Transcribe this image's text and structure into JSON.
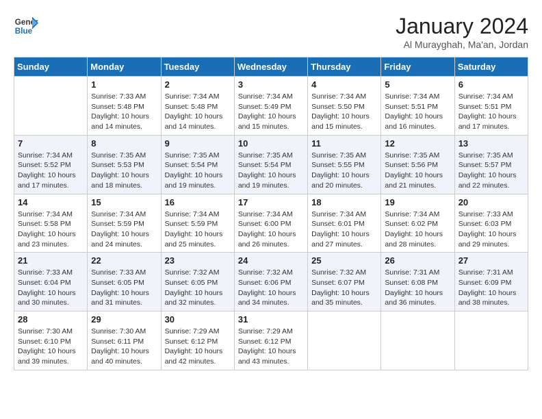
{
  "header": {
    "logo_line1": "General",
    "logo_line2": "Blue",
    "title": "January 2024",
    "subtitle": "Al Murayghah, Ma'an, Jordan"
  },
  "weekdays": [
    "Sunday",
    "Monday",
    "Tuesday",
    "Wednesday",
    "Thursday",
    "Friday",
    "Saturday"
  ],
  "weeks": [
    [
      {
        "day": "",
        "sunrise": "",
        "sunset": "",
        "daylight": ""
      },
      {
        "day": "1",
        "sunrise": "Sunrise: 7:33 AM",
        "sunset": "Sunset: 5:48 PM",
        "daylight": "Daylight: 10 hours and 14 minutes."
      },
      {
        "day": "2",
        "sunrise": "Sunrise: 7:34 AM",
        "sunset": "Sunset: 5:48 PM",
        "daylight": "Daylight: 10 hours and 14 minutes."
      },
      {
        "day": "3",
        "sunrise": "Sunrise: 7:34 AM",
        "sunset": "Sunset: 5:49 PM",
        "daylight": "Daylight: 10 hours and 15 minutes."
      },
      {
        "day": "4",
        "sunrise": "Sunrise: 7:34 AM",
        "sunset": "Sunset: 5:50 PM",
        "daylight": "Daylight: 10 hours and 15 minutes."
      },
      {
        "day": "5",
        "sunrise": "Sunrise: 7:34 AM",
        "sunset": "Sunset: 5:51 PM",
        "daylight": "Daylight: 10 hours and 16 minutes."
      },
      {
        "day": "6",
        "sunrise": "Sunrise: 7:34 AM",
        "sunset": "Sunset: 5:51 PM",
        "daylight": "Daylight: 10 hours and 17 minutes."
      }
    ],
    [
      {
        "day": "7",
        "sunrise": "Sunrise: 7:34 AM",
        "sunset": "Sunset: 5:52 PM",
        "daylight": "Daylight: 10 hours and 17 minutes."
      },
      {
        "day": "8",
        "sunrise": "Sunrise: 7:35 AM",
        "sunset": "Sunset: 5:53 PM",
        "daylight": "Daylight: 10 hours and 18 minutes."
      },
      {
        "day": "9",
        "sunrise": "Sunrise: 7:35 AM",
        "sunset": "Sunset: 5:54 PM",
        "daylight": "Daylight: 10 hours and 19 minutes."
      },
      {
        "day": "10",
        "sunrise": "Sunrise: 7:35 AM",
        "sunset": "Sunset: 5:54 PM",
        "daylight": "Daylight: 10 hours and 19 minutes."
      },
      {
        "day": "11",
        "sunrise": "Sunrise: 7:35 AM",
        "sunset": "Sunset: 5:55 PM",
        "daylight": "Daylight: 10 hours and 20 minutes."
      },
      {
        "day": "12",
        "sunrise": "Sunrise: 7:35 AM",
        "sunset": "Sunset: 5:56 PM",
        "daylight": "Daylight: 10 hours and 21 minutes."
      },
      {
        "day": "13",
        "sunrise": "Sunrise: 7:35 AM",
        "sunset": "Sunset: 5:57 PM",
        "daylight": "Daylight: 10 hours and 22 minutes."
      }
    ],
    [
      {
        "day": "14",
        "sunrise": "Sunrise: 7:34 AM",
        "sunset": "Sunset: 5:58 PM",
        "daylight": "Daylight: 10 hours and 23 minutes."
      },
      {
        "day": "15",
        "sunrise": "Sunrise: 7:34 AM",
        "sunset": "Sunset: 5:59 PM",
        "daylight": "Daylight: 10 hours and 24 minutes."
      },
      {
        "day": "16",
        "sunrise": "Sunrise: 7:34 AM",
        "sunset": "Sunset: 5:59 PM",
        "daylight": "Daylight: 10 hours and 25 minutes."
      },
      {
        "day": "17",
        "sunrise": "Sunrise: 7:34 AM",
        "sunset": "Sunset: 6:00 PM",
        "daylight": "Daylight: 10 hours and 26 minutes."
      },
      {
        "day": "18",
        "sunrise": "Sunrise: 7:34 AM",
        "sunset": "Sunset: 6:01 PM",
        "daylight": "Daylight: 10 hours and 27 minutes."
      },
      {
        "day": "19",
        "sunrise": "Sunrise: 7:34 AM",
        "sunset": "Sunset: 6:02 PM",
        "daylight": "Daylight: 10 hours and 28 minutes."
      },
      {
        "day": "20",
        "sunrise": "Sunrise: 7:33 AM",
        "sunset": "Sunset: 6:03 PM",
        "daylight": "Daylight: 10 hours and 29 minutes."
      }
    ],
    [
      {
        "day": "21",
        "sunrise": "Sunrise: 7:33 AM",
        "sunset": "Sunset: 6:04 PM",
        "daylight": "Daylight: 10 hours and 30 minutes."
      },
      {
        "day": "22",
        "sunrise": "Sunrise: 7:33 AM",
        "sunset": "Sunset: 6:05 PM",
        "daylight": "Daylight: 10 hours and 31 minutes."
      },
      {
        "day": "23",
        "sunrise": "Sunrise: 7:32 AM",
        "sunset": "Sunset: 6:05 PM",
        "daylight": "Daylight: 10 hours and 32 minutes."
      },
      {
        "day": "24",
        "sunrise": "Sunrise: 7:32 AM",
        "sunset": "Sunset: 6:06 PM",
        "daylight": "Daylight: 10 hours and 34 minutes."
      },
      {
        "day": "25",
        "sunrise": "Sunrise: 7:32 AM",
        "sunset": "Sunset: 6:07 PM",
        "daylight": "Daylight: 10 hours and 35 minutes."
      },
      {
        "day": "26",
        "sunrise": "Sunrise: 7:31 AM",
        "sunset": "Sunset: 6:08 PM",
        "daylight": "Daylight: 10 hours and 36 minutes."
      },
      {
        "day": "27",
        "sunrise": "Sunrise: 7:31 AM",
        "sunset": "Sunset: 6:09 PM",
        "daylight": "Daylight: 10 hours and 38 minutes."
      }
    ],
    [
      {
        "day": "28",
        "sunrise": "Sunrise: 7:30 AM",
        "sunset": "Sunset: 6:10 PM",
        "daylight": "Daylight: 10 hours and 39 minutes."
      },
      {
        "day": "29",
        "sunrise": "Sunrise: 7:30 AM",
        "sunset": "Sunset: 6:11 PM",
        "daylight": "Daylight: 10 hours and 40 minutes."
      },
      {
        "day": "30",
        "sunrise": "Sunrise: 7:29 AM",
        "sunset": "Sunset: 6:12 PM",
        "daylight": "Daylight: 10 hours and 42 minutes."
      },
      {
        "day": "31",
        "sunrise": "Sunrise: 7:29 AM",
        "sunset": "Sunset: 6:12 PM",
        "daylight": "Daylight: 10 hours and 43 minutes."
      },
      {
        "day": "",
        "sunrise": "",
        "sunset": "",
        "daylight": ""
      },
      {
        "day": "",
        "sunrise": "",
        "sunset": "",
        "daylight": ""
      },
      {
        "day": "",
        "sunrise": "",
        "sunset": "",
        "daylight": ""
      }
    ]
  ]
}
